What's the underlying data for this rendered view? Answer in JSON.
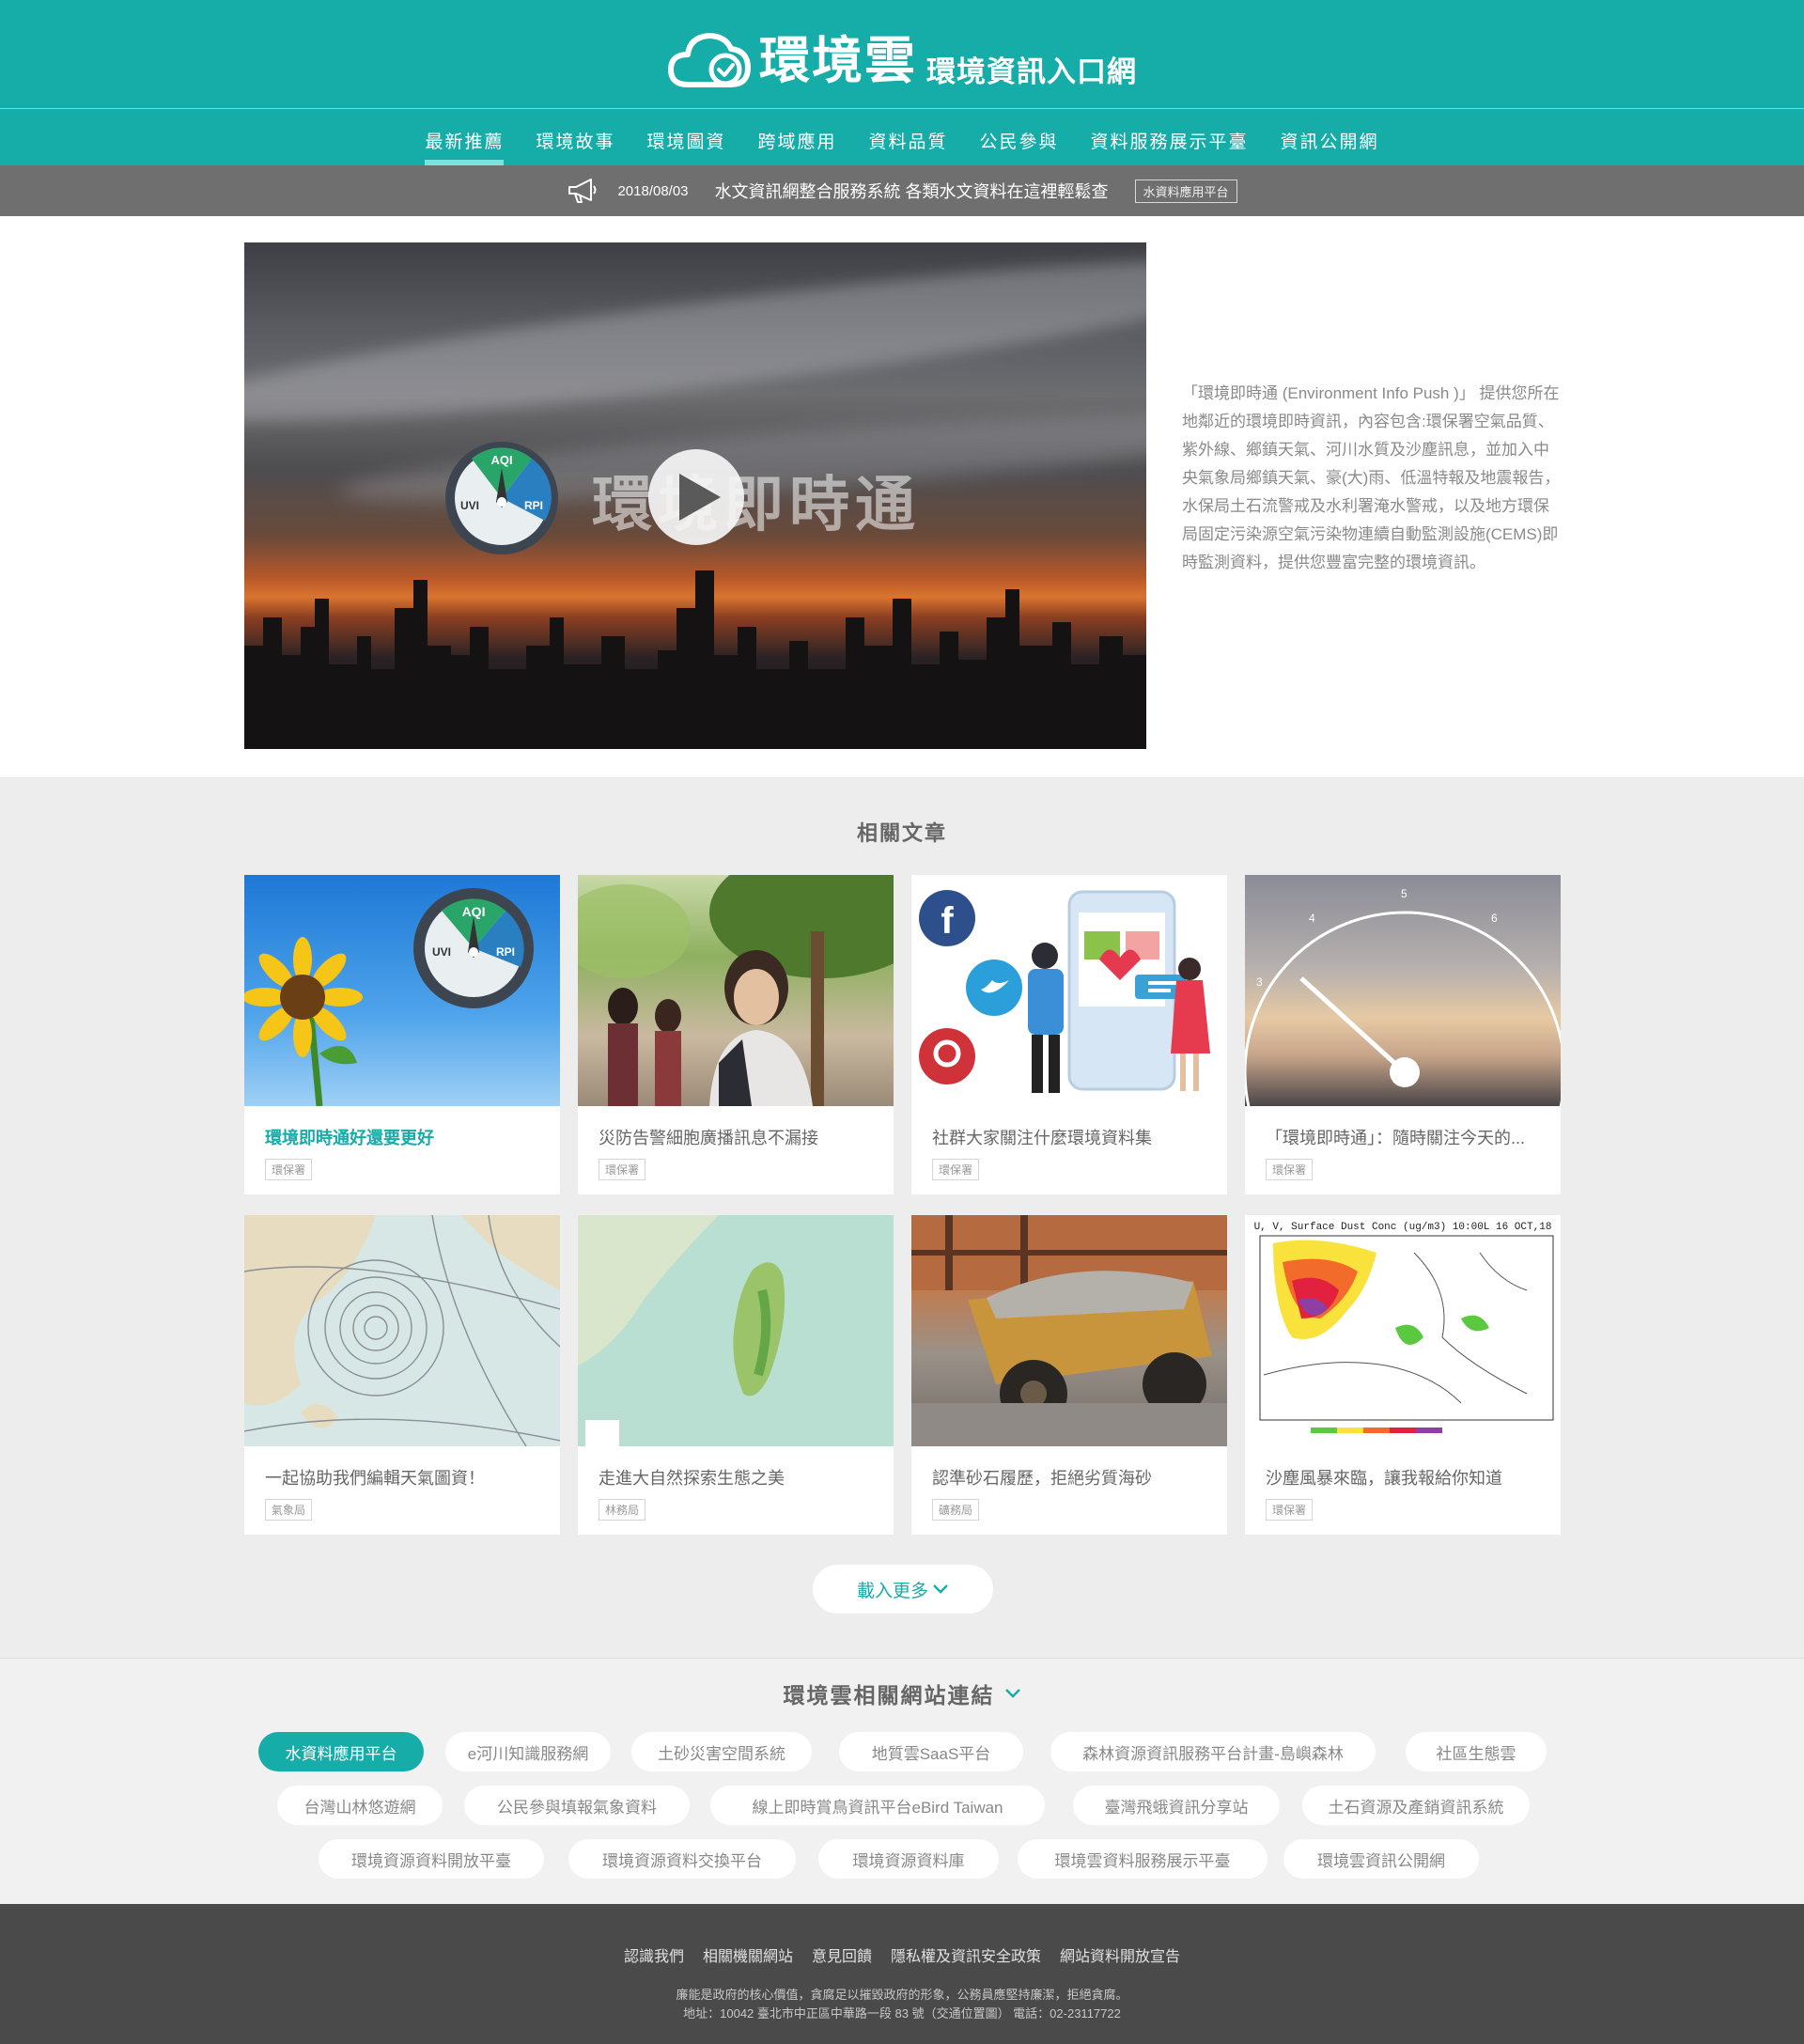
{
  "header": {
    "brand": "環境雲",
    "subtitle": "環境資訊入口網",
    "nav": [
      "最新推薦",
      "環境故事",
      "環境圖資",
      "跨域應用",
      "資料品質",
      "公民參與",
      "資料服務展示平臺",
      "資訊公開網"
    ]
  },
  "announcement": {
    "date": "2018/08/03",
    "message": "水文資訊網整合服務系統 各類水文資料在這裡輕鬆查",
    "tag": "水資料應用平台"
  },
  "hero": {
    "video_title": "環境即時通",
    "gauge": {
      "top": "AQI",
      "left": "UVI",
      "right": "RPI"
    },
    "description": "「環境即時通 (Environment Info Push )」 提供您所在地鄰近的環境即時資訊，內容包含:環保署空氣品質、紫外線、鄉鎮天氣、河川水質及沙塵訊息，並加入中央氣象局鄉鎮天氣、豪(大)雨、低溫特報及地震報告，水保局土石流警戒及水利署淹水警戒，以及地方環保局固定污染源空氣污染物連續自動監測設施(CEMS)即時監測資料，提供您豐富完整的環境資訊。"
  },
  "articles": {
    "title": "相關文章",
    "items": [
      {
        "title": "環境即時通好還要更好",
        "source": "環保署"
      },
      {
        "title": "災防告警細胞廣播訊息不漏接",
        "source": "環保署"
      },
      {
        "title": "社群大家關注什麼環境資料集",
        "source": "環保署"
      },
      {
        "title": "「環境即時通」：隨時關注今天的...",
        "source": "環保署"
      },
      {
        "title": "一起協助我們編輯天氣圖資！",
        "source": "氣象局"
      },
      {
        "title": "走進大自然探索生態之美",
        "source": "林務局"
      },
      {
        "title": "認準砂石履歷，拒絕劣質海砂",
        "source": "礦務局"
      },
      {
        "title": "沙塵風暴來臨，讓我報給你知道",
        "source": "環保署"
      }
    ],
    "dust_chart_title": "U, V, Surface Dust Conc (ug/m3)  10:00L 16 OCT,18",
    "gauge_numbers": [
      "3",
      "4",
      "5",
      "6"
    ],
    "load_more": "載入更多"
  },
  "related_sites": {
    "title": "環境雲相關網站連結",
    "items": [
      "水資料應用平台",
      "e河川知識服務網",
      "土砂災害空間系統",
      "地質雲SaaS平台",
      "森林資源資訊服務平台計畫-島嶼森林",
      "社區生態雲",
      "台灣山林悠遊網",
      "公民參與填報氣象資料",
      "線上即時賞鳥資訊平台eBird Taiwan",
      "臺灣飛蛾資訊分享站",
      "土石資源及產銷資訊系統",
      "環境資源資料開放平臺",
      "環境資源資料交換平台",
      "環境資源資料庫",
      "環境雲資料服務展示平臺",
      "環境雲資訊公開網"
    ]
  },
  "footer": {
    "links": [
      "認識我們",
      "相關機關網站",
      "意見回饋",
      "隱私權及資訊安全政策",
      "網站資料開放宣告"
    ],
    "slogan": "廉能是政府的核心價值，貪腐足以摧毀政府的形象，公務員應堅持廉潔，拒絕貪腐。",
    "address": "地址：10042 臺北市中正區中華路一段 83 號（交通位置圖）  電話：02-23117722"
  },
  "colors": {
    "primary": "#16aca8",
    "announce_bg": "#6f6f6f",
    "footer_bg": "#4a4a4a"
  }
}
